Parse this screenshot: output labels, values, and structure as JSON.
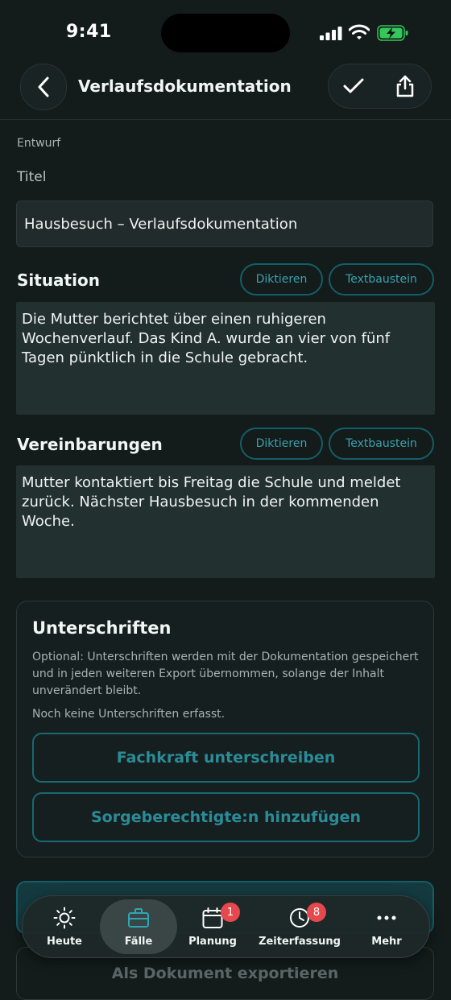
{
  "status": {
    "time": "9:41"
  },
  "nav": {
    "title": "Verlaufsdokumentation"
  },
  "form": {
    "draft_label": "Entwurf",
    "title_label": "Titel",
    "title_value": "Hausbesuch – Verlaufsdokumentation",
    "situation": {
      "heading": "Situation",
      "dictate_label": "Diktieren",
      "snippet_label": "Textbaustein",
      "text": "Die Mutter berichtet über einen ruhigeren Wochenverlauf. Das Kind A. wurde an vier von fünf Tagen pünktlich in die Schule gebracht."
    },
    "agreements": {
      "heading": "Vereinbarungen",
      "dictate_label": "Diktieren",
      "snippet_label": "Textbaustein",
      "text": "Mutter kontaktiert bis Freitag die Schule und meldet zurück. Nächster Hausbesuch in der kommenden Woche."
    }
  },
  "signatures": {
    "title": "Unterschriften",
    "description": "Optional: Unterschriften werden mit der Dokumentation gespeichert und in jeden weiteren Export übernommen, solange der Inhalt unverändert bleibt.",
    "empty_state": "Noch keine Unterschriften erfasst.",
    "sign_button": "Fachkraft unterschreiben",
    "add_guardian_button": "Sorgeberechtigte:n hinzufügen"
  },
  "actions": {
    "export_button": "Als Dokument exportieren"
  },
  "tabbar": {
    "items": [
      {
        "label": "Heute",
        "icon": "sun-icon"
      },
      {
        "label": "Fälle",
        "icon": "briefcase-icon",
        "active": true
      },
      {
        "label": "Planung",
        "icon": "calendar-icon",
        "badge": "1"
      },
      {
        "label": "Zeiterfassung",
        "icon": "clock-icon",
        "badge": "8"
      },
      {
        "label": "Mehr",
        "icon": "more-icon"
      }
    ]
  },
  "colors": {
    "background": "#131b1b",
    "accent": "#2b8c98",
    "badge": "#e5484d",
    "battery": "#34c759"
  }
}
